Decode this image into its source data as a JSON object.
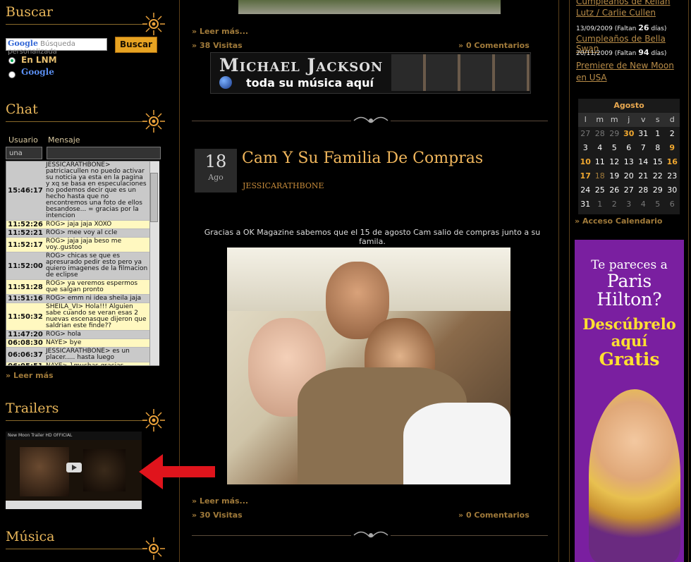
{
  "left": {
    "search": {
      "title": "Buscar",
      "input_placeholder": "Búsqueda personalizada",
      "google_logo": "Google",
      "button": "Buscar",
      "option_site": "En LNM",
      "option_google": "Google"
    },
    "chat": {
      "title": "Chat",
      "col_user": "Usuario",
      "col_message": "Mensaje",
      "user_value": "una",
      "rows": [
        {
          "time": "15:46:17",
          "msg": "JESSICARATHBONE> patriciacullen no puedo activar su noticia ya esta en la pagina y xq se basa en especulaciones no podemos decir que es un hecho hasta que no encontremos una foto de ellos besandose... = gracias por la intencion",
          "tone": "g"
        },
        {
          "time": "11:52:26",
          "msg": "ROG> jaja jaja XOXO",
          "tone": "y"
        },
        {
          "time": "11:52:21",
          "msg": "ROG> mee voy al ccle",
          "tone": "g"
        },
        {
          "time": "11:52:17",
          "msg": "ROG> jaja jaja beso me voy..gustoo",
          "tone": "y"
        },
        {
          "time": "11:52:00",
          "msg": "ROG> chicas se que es apresurado pedir esto pero ya quiero imagenes de la filmacion de eclipse",
          "tone": "g"
        },
        {
          "time": "11:51:28",
          "msg": "ROG> ya veremos espermos que salgan pronto",
          "tone": "y"
        },
        {
          "time": "11:51:16",
          "msg": "ROG> emm ni idea sheila jaja",
          "tone": "g"
        },
        {
          "time": "11:50:32",
          "msg": "SHEILA_VI> Hola!!! Alguien sabe cuando se veran esas 2 nuevas escenasque dijeron que saldrian este finde??",
          "tone": "y"
        },
        {
          "time": "11:47:20",
          "msg": "ROG> hola",
          "tone": "g"
        },
        {
          "time": "06:08:30",
          "msg": "NAYE> bye",
          "tone": "y"
        },
        {
          "time": "06:06:37",
          "msg": "JESSICARATHBONE> es un placer..... hasta luego",
          "tone": "g"
        },
        {
          "time": "06:05:51",
          "msg": "NAYE> }muchas gracias",
          "tone": "y"
        }
      ],
      "more": "Leer más"
    },
    "trailers": {
      "title": "Trailers",
      "video_caption": "New Moon Trailer HD OFFICIAL"
    },
    "music": {
      "title": "Música"
    }
  },
  "center": {
    "post1": {
      "read_more": "Leer más...",
      "visits": "38 Visitas",
      "comments": "0 Comentarios"
    },
    "banner": {
      "line1": "Michael Jackson",
      "line2": "toda su música aquí"
    },
    "post2": {
      "day": "18",
      "month": "Ago",
      "title": "Cam Y Su Familia De Compras",
      "author": "JESSICARATHBONE",
      "text": "Gracias a OK Magazine sabemos que el 15 de agosto Cam salio de compras junto a su famila.",
      "read_more": "Leer más...",
      "visits": "30 Visitas",
      "comments": "0 Comentarios"
    }
  },
  "right": {
    "birthdays": [
      {
        "link": "Cumpleaños de Kellan Lutz / Carlie Cullen",
        "date": "",
        "note": ""
      },
      {
        "link": "Cumpleaños de Bella Swan",
        "date": "13/09/2009",
        "note_pre": "(Faltan ",
        "days": "26",
        "note_post": " días)"
      },
      {
        "link": "Premiere de New Moon en USA",
        "date": "20/11/2009",
        "note_pre": "(Faltan ",
        "days": "94",
        "note_post": " días)"
      }
    ],
    "calendar": {
      "month": "Agosto",
      "weekdays": [
        "l",
        "m",
        "m",
        "j",
        "v",
        "s",
        "d"
      ],
      "cells": [
        [
          "27",
          "dim"
        ],
        [
          "28",
          "dim"
        ],
        [
          "29",
          "dim"
        ],
        [
          "30",
          "hl"
        ],
        [
          "31",
          "n"
        ],
        [
          "1",
          "n"
        ],
        [
          "2",
          "n"
        ],
        [
          "3",
          "n"
        ],
        [
          "4",
          "n"
        ],
        [
          "5",
          "n"
        ],
        [
          "6",
          "n"
        ],
        [
          "7",
          "n"
        ],
        [
          "8",
          "n"
        ],
        [
          "9",
          "hl"
        ],
        [
          "10",
          "hl"
        ],
        [
          "11",
          "n"
        ],
        [
          "12",
          "n"
        ],
        [
          "13",
          "n"
        ],
        [
          "14",
          "n"
        ],
        [
          "15",
          "n"
        ],
        [
          "16",
          "hl"
        ],
        [
          "17",
          "hl"
        ],
        [
          "18",
          "today"
        ],
        [
          "19",
          "n"
        ],
        [
          "20",
          "n"
        ],
        [
          "21",
          "n"
        ],
        [
          "22",
          "n"
        ],
        [
          "23",
          "n"
        ],
        [
          "24",
          "n"
        ],
        [
          "25",
          "n"
        ],
        [
          "26",
          "n"
        ],
        [
          "27",
          "n"
        ],
        [
          "28",
          "n"
        ],
        [
          "29",
          "n"
        ],
        [
          "30",
          "n"
        ],
        [
          "31",
          "n"
        ],
        [
          "1",
          "dim"
        ],
        [
          "2",
          "dim"
        ],
        [
          "3",
          "dim"
        ],
        [
          "4",
          "dim"
        ],
        [
          "5",
          "dim"
        ],
        [
          "6",
          "dim"
        ]
      ],
      "access": "Acceso Calendario"
    },
    "ad": {
      "line1": "Te pareces a",
      "line2": "Paris",
      "line3": "Hilton?",
      "line4": "Descúbrelo",
      "line5": "aquí",
      "line6": "Gratis"
    }
  },
  "colors": {
    "gold": "#e8b65a",
    "orange": "#e7a322",
    "purple_ad": "#7a1fa0",
    "arrow": "#e0141c"
  }
}
